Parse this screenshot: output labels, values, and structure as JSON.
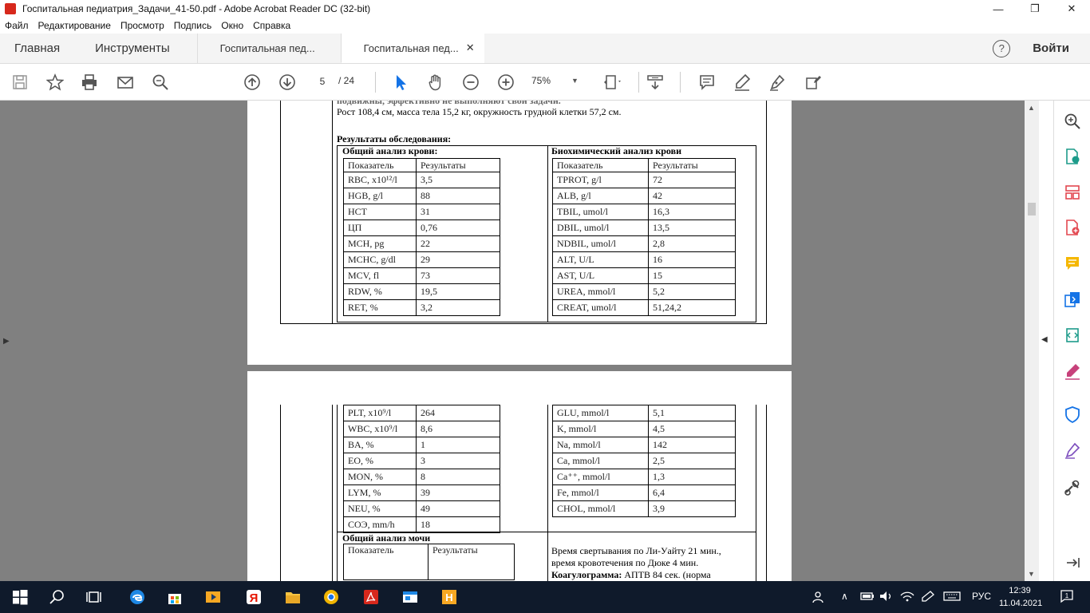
{
  "window": {
    "title": "Госпитальная педиатрия_Задачи_41-50.pdf - Adobe Acrobat Reader DC (32-bit)",
    "minimize": "—",
    "maximize": "❐",
    "close": "✕"
  },
  "menu": [
    "Файл",
    "Редактирование",
    "Просмотр",
    "Подпись",
    "Окно",
    "Справка"
  ],
  "tabs": {
    "home": "Главная",
    "tools": "Инструменты",
    "doc1": "Госпитальная пед...",
    "doc2": "Госпитальная пед...",
    "close": "✕",
    "help": "?",
    "login": "Войти"
  },
  "toolbar": {
    "page_current": "5",
    "page_total": "/ 24",
    "zoom": "75%"
  },
  "page1": {
    "cut_line": "подвижны, эффективно не выполняют свои задачи.",
    "growth": "Рост 108,4 см, масса тела 15,2 кг, окружность грудной клетки 57,2 см.",
    "results_title": "Результаты обследования:",
    "cbc_title": "Общий анализ крови:",
    "bio_title": "Биохимический анализ крови",
    "col_param": "Показатель",
    "col_result": "Результаты",
    "cbc_rows": [
      [
        "RBC, x10¹²/l",
        "3,5"
      ],
      [
        "HGB, g/l",
        "88"
      ],
      [
        "HCT",
        "31"
      ],
      [
        "ЦП",
        "0,76"
      ],
      [
        "MCH, pg",
        "22"
      ],
      [
        "MCHC, g/dl",
        "29"
      ],
      [
        "MCV, fl",
        "73"
      ],
      [
        "RDW, %",
        "19,5"
      ],
      [
        "RET, %",
        "3,2"
      ]
    ],
    "bio_rows": [
      [
        "TPROT, g/l",
        "72"
      ],
      [
        "ALB, g/l",
        "42"
      ],
      [
        "TBIL, umol/l",
        "16,3"
      ],
      [
        "DBIL, umol/l",
        "13,5"
      ],
      [
        "NDBIL, umol/l",
        "2,8"
      ],
      [
        "ALT, U/L",
        "16"
      ],
      [
        "AST, U/L",
        "15"
      ],
      [
        "UREA, mmol/l",
        "5,2"
      ],
      [
        "CREAT, umol/l",
        "51,24,2"
      ]
    ]
  },
  "page2": {
    "cbc_rows": [
      [
        "PLT, x10⁹/l",
        "264"
      ],
      [
        "WBC, x10⁹/l",
        "8,6"
      ],
      [
        "BA, %",
        "1"
      ],
      [
        "EO, %",
        "3"
      ],
      [
        "MON, %",
        "8"
      ],
      [
        "LYM, %",
        "39"
      ],
      [
        "NEU, %",
        "49"
      ],
      [
        "СОЭ, mm/h",
        "18"
      ]
    ],
    "bio_rows": [
      [
        "GLU, mmol/l",
        "5,1"
      ],
      [
        "K, mmol/l",
        "4,5"
      ],
      [
        "Na, mmol/l",
        "142"
      ],
      [
        "Ca, mmol/l",
        "2,5"
      ],
      [
        "Ca⁺⁺, mmol/l",
        "1,3"
      ],
      [
        "Fe, mmol/l",
        "6,4"
      ],
      [
        "CHOL, mmol/l",
        "3,9"
      ]
    ],
    "urine_title": "Общий анализ мочи",
    "urine_param": "Показатель",
    "urine_result": "Результаты",
    "clotting_1": "Время свертывания по Ли-Уайту 21 мин.,",
    "clotting_2": "время кровотечения по Дюке 4 мин.",
    "coag_label": "Коагулограмма:",
    "coag_text": " АПТВ 84 сек. (норма"
  },
  "taskbar": {
    "lang": "РУС",
    "time": "12:39",
    "date": "11.04.2021",
    "notif": "1"
  },
  "colors": {
    "acrobat_red": "#d7281c",
    "viewer_bg": "#808080",
    "taskbar_bg": "#0f1a2b",
    "accent_blue": "#1473e6"
  }
}
